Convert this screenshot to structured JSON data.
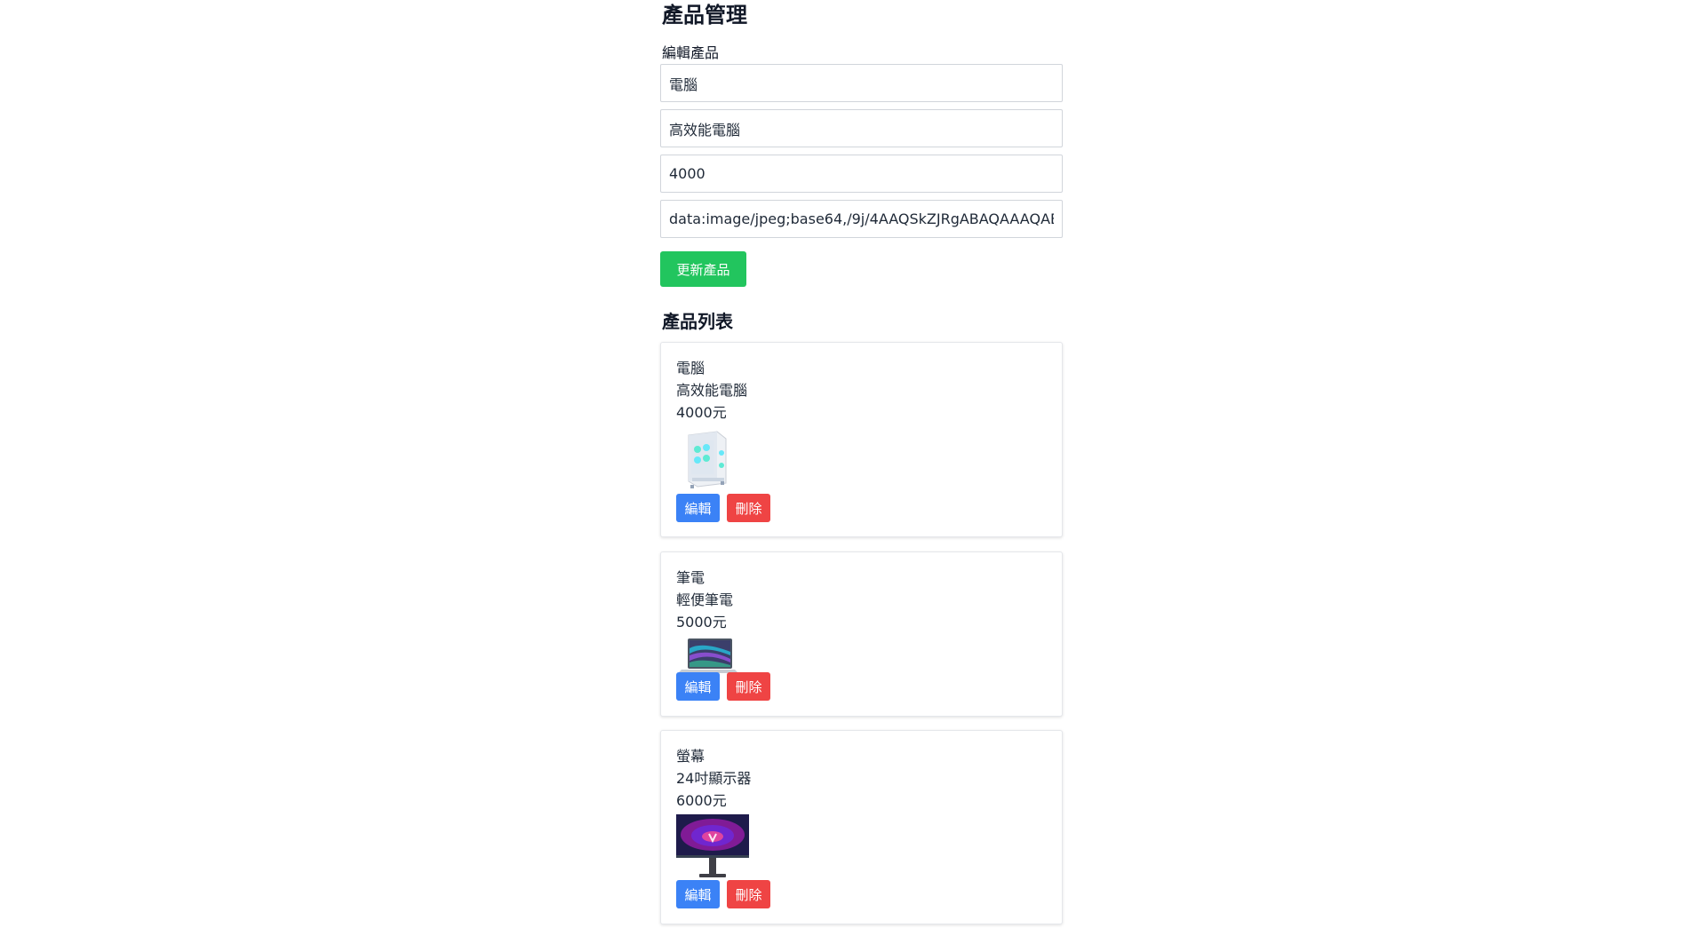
{
  "header": {
    "title": "產品管理"
  },
  "form": {
    "label": "編輯產品",
    "name_value": "電腦",
    "description_value": "高效能電腦",
    "price_value": "4000",
    "image_value": "data:image/jpeg;base64,/9j/4AAQSkZJRgABAQAAAQABAAD",
    "submit_label": "更新產品"
  },
  "list": {
    "title": "產品列表",
    "products": [
      {
        "name": "電腦",
        "description": "高效能電腦",
        "price": "4000元",
        "edit_label": "編輯",
        "delete_label": "刪除",
        "image_icon": "pc-case-image"
      },
      {
        "name": "筆電",
        "description": "輕便筆電",
        "price": "5000元",
        "edit_label": "編輯",
        "delete_label": "刪除",
        "image_icon": "laptop-image"
      },
      {
        "name": "螢幕",
        "description": "24吋顯示器",
        "price": "6000元",
        "edit_label": "編輯",
        "delete_label": "刪除",
        "image_icon": "monitor-image"
      }
    ]
  },
  "colors": {
    "update": "#22c55e",
    "edit": "#3b82f6",
    "delete": "#ef4444"
  }
}
